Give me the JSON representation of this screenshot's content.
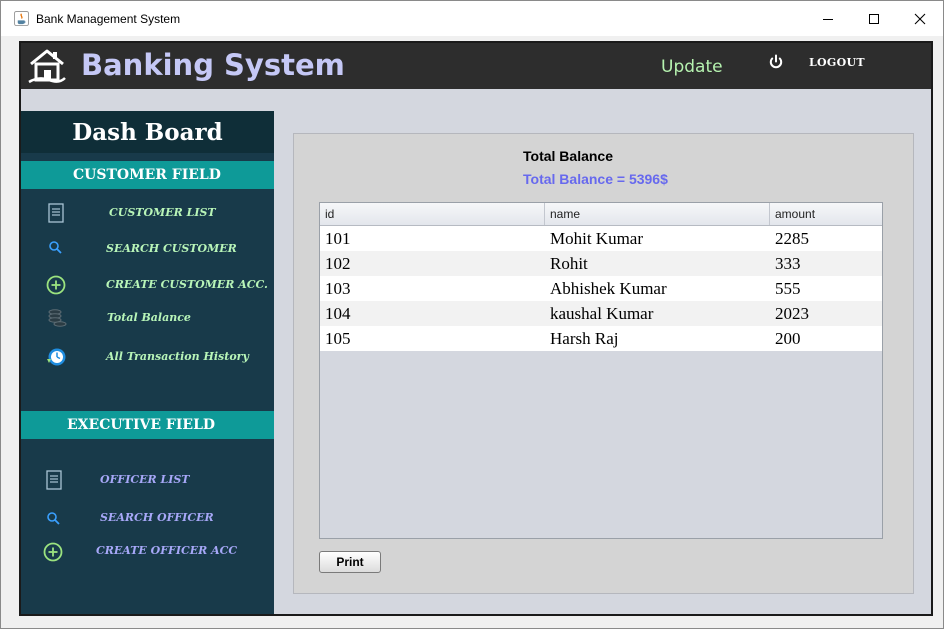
{
  "window": {
    "title": "Bank Management System"
  },
  "header": {
    "app_title": "Banking System",
    "update_label": "Update",
    "logout_label": "LOGOUT"
  },
  "sidebar": {
    "dashboard_title": "Dash Board",
    "customer_section": "CUSTOMER FIELD",
    "customer_items": [
      {
        "label": "CUSTOMER LIST",
        "icon": "document-icon"
      },
      {
        "label": "SEARCH CUSTOMER",
        "icon": "search-icon"
      },
      {
        "label": "CREATE CUSTOMER ACC.",
        "icon": "plus-circle-icon"
      },
      {
        "label": "Total Balance",
        "icon": "coins-icon"
      },
      {
        "label": "All Transaction History",
        "icon": "history-icon"
      }
    ],
    "executive_section": "EXECUTIVE FIELD",
    "executive_items": [
      {
        "label": "OFFICER LIST",
        "icon": "document-icon"
      },
      {
        "label": "SEARCH OFFICER",
        "icon": "search-icon"
      },
      {
        "label": "CREATE OFFICER ACC",
        "icon": "plus-circle-icon"
      }
    ]
  },
  "main": {
    "heading": "Total Balance",
    "total_text": "Total Balance = 5396$",
    "table": {
      "columns": [
        "id",
        "name",
        "amount"
      ],
      "rows": [
        [
          "101",
          "Mohit Kumar",
          "2285"
        ],
        [
          "102",
          "Rohit",
          "333"
        ],
        [
          "103",
          "Abhishek Kumar",
          "555"
        ],
        [
          "104",
          "kaushal Kumar",
          "2023"
        ],
        [
          "105",
          "Harsh Raj",
          "200"
        ]
      ]
    },
    "print_label": "Print"
  },
  "colors": {
    "sidebar_bg": "#183a4a",
    "section_bg": "#0e9a98",
    "header_bg": "#2d2d2d",
    "title_color": "#c5c8f6",
    "accent_blue": "#6769ee"
  }
}
